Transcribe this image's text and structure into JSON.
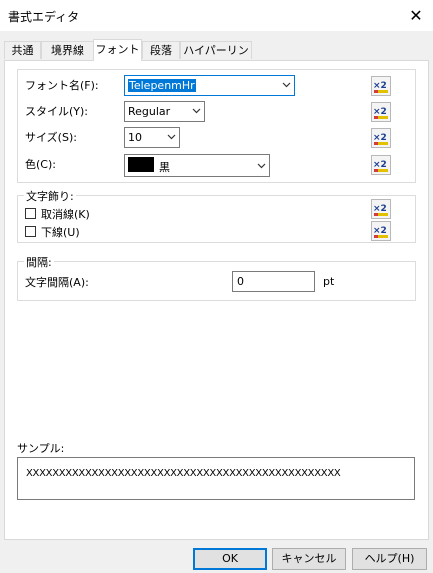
{
  "window": {
    "title": "書式エディタ"
  },
  "tabs": [
    {
      "label": "共通"
    },
    {
      "label": "境界線"
    },
    {
      "label": "フォント"
    },
    {
      "label": "段落"
    },
    {
      "label": "ハイパーリンク"
    }
  ],
  "active_tab": "フォント",
  "font": {
    "font_name_label": "フォント名(F):",
    "font_name_value": "TelepenmHr",
    "style_label": "スタイル(Y):",
    "style_value": "Regular",
    "size_label": "サイズ(S):",
    "size_value": "10",
    "color_label": "色(C):",
    "color_value": "黒",
    "color_swatch": "#000000"
  },
  "decoration": {
    "title": "文字飾り:",
    "strikethrough_label": "取消線(K)",
    "strikethrough_checked": false,
    "underline_label": "下線(U)",
    "underline_checked": false
  },
  "spacing": {
    "title": "間隔:",
    "char_spacing_label": "文字間隔(A):",
    "char_spacing_value": "0",
    "unit": "pt"
  },
  "sample": {
    "label": "サンプル:",
    "text": "XXXXXXXXXXXXXXXXXXXXXXXXXXXXXXXXXXXXXXXXXXXXXXXX"
  },
  "buttons": {
    "ok": "OK",
    "cancel": "キャンセル",
    "help": "ヘルプ(H)"
  },
  "icons": {
    "reset": "x2-reset-icon",
    "close": "close-icon",
    "dropdown": "chevron-down-icon"
  }
}
